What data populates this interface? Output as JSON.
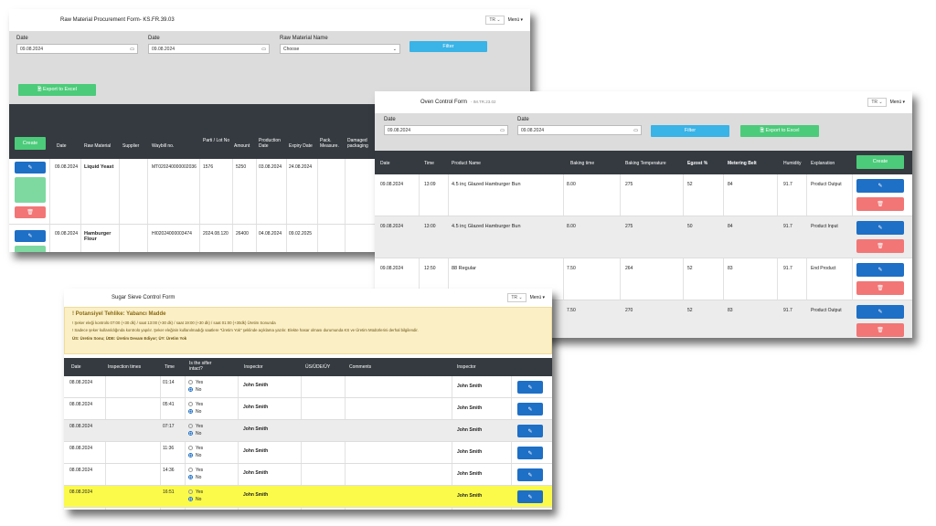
{
  "s1": {
    "title": "Raw Material Procurement Form- KS.FR.39.03",
    "lang": "TR",
    "menu": "Menü ▾",
    "date_label": "Date",
    "date2_label": "Date",
    "date1": "09.08.2024",
    "date2": "09.08.2024",
    "rm_label": "Raw Material Name",
    "rm_value": "Choose",
    "filter": "Filter",
    "export": "Export to Excel",
    "create": "Create",
    "headers": [
      "Date",
      "Raw Material",
      "Supplier",
      "Waybill no.",
      "Parti / Lot No",
      "Amount",
      "Production Date",
      "Expiry Date",
      "Pack. Measure.",
      "Damaged packaging",
      "D"
    ],
    "rows": [
      {
        "date": "09.08.2024",
        "material": "Liquid Yeast",
        "supplier": "",
        "waybill": "MT020240000002036",
        "lot": "1576",
        "amount": "5250",
        "prod": "03.08.2024",
        "exp": "24.08.2024"
      },
      {
        "date": "09.08.2024",
        "material": "Hamburger Flour",
        "supplier": "",
        "waybill": "HI02024000003474",
        "lot": "2024.08.120",
        "amount": "26400",
        "prod": "04.08.2024",
        "exp": "09.02.2025"
      }
    ]
  },
  "s2": {
    "title": "Oven Control Form",
    "code": "- IM.TR.23.02",
    "lang": "TR",
    "menu": "Menü ▾",
    "date_label": "Date",
    "date2_label": "Date",
    "date1": "09.08.2024",
    "date2": "09.08.2024",
    "filter": "Filter",
    "export": "Export to Excel",
    "create": "Create",
    "headers": [
      "Date",
      "Time",
      "Product Name",
      "Baking time",
      "Baking Temperature",
      "Egzost %",
      "Metering Belt",
      "Humidity",
      "Explanation"
    ],
    "rows": [
      {
        "date": "09.08.2024",
        "time": "13:09",
        "product": "4.5 inç Glazed Hamburger Bun",
        "bt": "8.00",
        "temp": "275",
        "egz": "52",
        "belt": "84",
        "hum": "91.7",
        "exp": "Product Output"
      },
      {
        "date": "09.08.2024",
        "time": "13:00",
        "product": "4.5 inç Glazed Hamburger Bun",
        "bt": "8.00",
        "temp": "275",
        "egz": "50",
        "belt": "84",
        "hum": "91.7",
        "exp": "Product Input"
      },
      {
        "date": "09.08.2024",
        "time": "12:50",
        "product": "88 Regular",
        "bt": "7.50",
        "temp": "264",
        "egz": "52",
        "belt": "83",
        "hum": "91.7",
        "exp": "End Product"
      },
      {
        "date": "",
        "time": "",
        "product": "",
        "bt": "7.50",
        "temp": "270",
        "egz": "52",
        "belt": "83",
        "hum": "91.7",
        "exp": "Product Output"
      }
    ]
  },
  "s3": {
    "title": "Sugar Sieve Control Form",
    "lang": "TR",
    "menu": "Menü ▾",
    "warn_title": "! Potansiyel Tehlike: Yabancı Madde",
    "warn1": "! Şeker eleği kontrolü 07:00 (+30 dk) / saat 13:00 (+30 dk) / saat 19:00 (+30 dk) / saat 01:00 (+30dk) Üretim Sonunda",
    "warn2": "! Sadece şeker kullanıldığında kontrolü yapılır. Şeker eleğinin kullanılmadığı saatlere \"Üretim Yok\" şeklinde açıklama yazılır. Elekte hasar olması durumunda KS ve Üretim Müdürlerini derhal bilgilendir.",
    "warn3": "ÜS: Üretim Sonu; ÜDE: Üretim Devam Ediyor; ÜY: Üretim Yok",
    "headers": [
      "Date",
      "Inspection times",
      "Time",
      "Is the sifter intact?",
      "Inspector",
      "ÜS/ÜDE/ÜY",
      "Comments",
      "Inspector"
    ],
    "yes": "Yes",
    "no": "No",
    "rows": [
      {
        "date": "08.08.2024",
        "time": "01:14",
        "insp": "John Smith",
        "insp2": "John Smith"
      },
      {
        "date": "08.08.2024",
        "time": "05:41",
        "insp": "John Smith",
        "insp2": "John Smith"
      },
      {
        "date": "08.08.2024",
        "time": "07:17",
        "insp": "John Smith",
        "insp2": "John Smith"
      },
      {
        "date": "08.08.2024",
        "time": "11:36",
        "insp": "John Smith",
        "insp2": "John Smith"
      },
      {
        "date": "08.08.2024",
        "time": "14:36",
        "insp": "John Smith",
        "insp2": "John Smith"
      },
      {
        "date": "08.08.2024",
        "time": "16:51",
        "insp": "John Smith",
        "insp2": "John Smith"
      }
    ]
  },
  "colors": {
    "edit": "#1e6fc6",
    "delete": "#f27676",
    "green": "#4ccb7a",
    "filter": "#3ab3e6",
    "header": "#343a40",
    "highlight": "#fbfa4a"
  }
}
